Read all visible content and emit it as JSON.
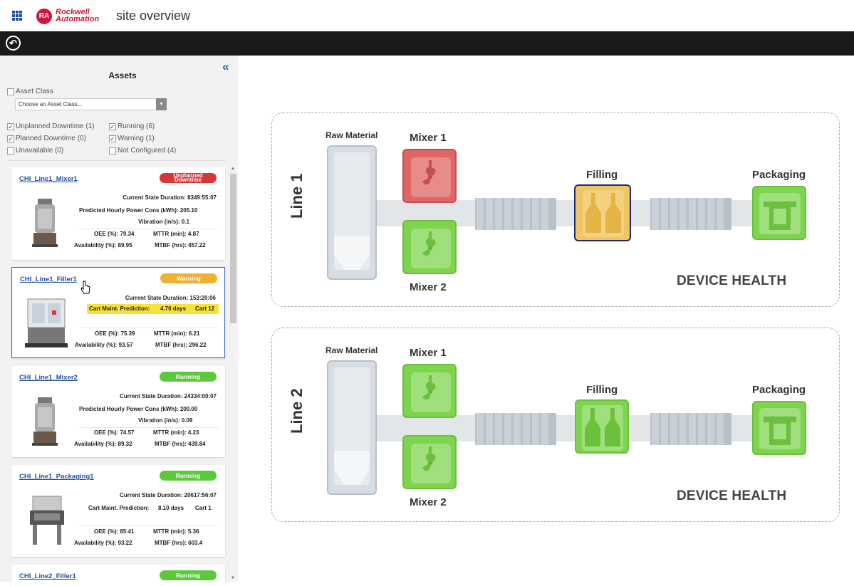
{
  "header": {
    "title": "site overview",
    "logo_initials": "RA",
    "brand_line1": "Rockwell",
    "brand_line2": "Automation",
    "grid_icon": "app-grid-icon",
    "brand_color": "#cd163f"
  },
  "toolbar": {
    "back_icon": "back-arrow-icon"
  },
  "sidebar": {
    "title": "Assets",
    "collapse_glyph": "«",
    "asset_class_label": "Asset Class",
    "asset_class_placeholder": "Choose an Asset Class...",
    "filters": [
      {
        "label": "Unplanned Downtime (1)",
        "checked": true
      },
      {
        "label": "Running (6)",
        "checked": true
      },
      {
        "label": "Planned Downtime (0)",
        "checked": true
      },
      {
        "label": "Warning (1)",
        "checked": true
      },
      {
        "label": "Unavailable (0)",
        "checked": false
      },
      {
        "label": "Not Configured (4)",
        "checked": false
      }
    ],
    "cards": [
      {
        "name": "CHI_Line1_Mixer1",
        "status": "Unplanned Downtime",
        "status_color": "#d63636",
        "duration_label": "Current State Duration:",
        "duration": "8349:55:07",
        "power_label": "Predicted Hourly Power Cons (kWh):",
        "power": "205.10",
        "vibration_label": "Vibration (in/s):",
        "vibration": "0.1",
        "oee_label": "OEE (%):",
        "oee": "79.34",
        "mttr_label": "MTTR (min):",
        "mttr": "4.87",
        "availability_label": "Availability (%):",
        "availability": "89.95",
        "mtbf_label": "MTBF (hrs):",
        "mtbf": "457.22"
      },
      {
        "name": "CHI_Line1_Filler1",
        "status": "Warning",
        "status_color": "#f0b132",
        "duration_label": "Current State Duration:",
        "duration": "153:20:06",
        "maint_label": "Cart Maint. Prediction:",
        "maint_days": "4.70 days",
        "maint_cart": "Cart 12",
        "oee_label": "OEE (%):",
        "oee": "75.39",
        "mttr_label": "MTTR (min):",
        "mttr": "6.21",
        "availability_label": "Availability (%):",
        "availability": "93.57",
        "mtbf_label": "MTBF (hrs):",
        "mtbf": "296.22"
      },
      {
        "name": "CHI_Line1_Mixer2",
        "status": "Running",
        "status_color": "#5cc83b",
        "duration_label": "Current State Duration:",
        "duration": "24334:00:07",
        "power_label": "Predicted Hourly Power Cons (kWh):",
        "power": "200.00",
        "vibration_label": "Vibration (in/s):",
        "vibration": "0.09",
        "oee_label": "OEE (%):",
        "oee": "74.57",
        "mttr_label": "MTTR (min):",
        "mttr": "4.23",
        "availability_label": "Availability (%):",
        "availability": "89.32",
        "mtbf_label": "MTBF (hrs):",
        "mtbf": "439.84"
      },
      {
        "name": "CHI_Line1_Packaging1",
        "status": "Running",
        "status_color": "#5cc83b",
        "duration_label": "Current State Duration:",
        "duration": "20617:56:07",
        "maint_label": "Cart Maint. Prediction:",
        "maint_days": "8.10 days",
        "maint_cart": "Cart 1",
        "oee_label": "OEE (%):",
        "oee": "85.41",
        "mttr_label": "MTTR (min):",
        "mttr": "5.36",
        "availability_label": "Availability (%):",
        "availability": "93.22",
        "mtbf_label": "MTBF (hrs):",
        "mtbf": "603.4"
      },
      {
        "name": "CHI_Line2_Filler1",
        "status": "Running",
        "status_color": "#5cc83b"
      }
    ]
  },
  "lines": [
    {
      "label": "Line 1",
      "raw_material": "Raw Material",
      "mixer1": "Mixer 1",
      "mixer1_status": "red",
      "mixer2": "Mixer 2",
      "mixer2_status": "green",
      "filling": "Filling",
      "filling_status": "yellow",
      "packaging": "Packaging",
      "packaging_status": "green",
      "device_health": "DEVICE HEALTH"
    },
    {
      "label": "Line 2",
      "raw_material": "Raw Material",
      "mixer1": "Mixer 1",
      "mixer1_status": "green",
      "mixer2": "Mixer 2",
      "mixer2_status": "green",
      "filling": "Filling",
      "filling_status": "green",
      "packaging": "Packaging",
      "packaging_status": "green",
      "device_health": "DEVICE HEALTH"
    }
  ]
}
